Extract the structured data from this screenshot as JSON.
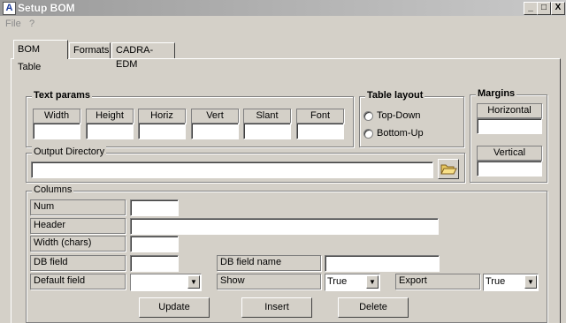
{
  "window": {
    "title": "Setup BOM",
    "minimize": "_",
    "maximize": "□",
    "close": "X"
  },
  "menu": {
    "file": "File",
    "help": "?"
  },
  "tabs": [
    {
      "label": "BOM Table",
      "active": true
    },
    {
      "label": "Formats",
      "active": false
    },
    {
      "label": "CADRA-EDM",
      "active": false
    }
  ],
  "text_params": {
    "title": "Text params",
    "columns": [
      "Width",
      "Height",
      "Horiz",
      "Vert",
      "Slant",
      "Font"
    ],
    "values": [
      "",
      "",
      "",
      "",
      "",
      ""
    ]
  },
  "table_layout": {
    "title": "Table layout",
    "options": [
      "Top-Down",
      "Bottom-Up"
    ],
    "selected": ""
  },
  "margins": {
    "title": "Margins",
    "horizontal_label": "Horizontal",
    "horizontal_value": "",
    "vertical_label": "Vertical",
    "vertical_value": ""
  },
  "output_directory": {
    "label": "Output Directory",
    "value": ""
  },
  "columns_group": {
    "title": "Columns",
    "num_label": "Num",
    "num_value": "",
    "header_label": "Header",
    "header_value": "",
    "width_label": "Width  (chars)",
    "width_value": "",
    "db_field_label": "DB field",
    "db_field_value": "",
    "db_field_name_label": "DB field name",
    "db_field_name_value": "",
    "default_field_label": "Default field",
    "default_field_value": "",
    "show_label": "Show",
    "show_value": "True",
    "export_label": "Export",
    "export_value": "True"
  },
  "buttons": {
    "update": "Update",
    "insert": "Insert",
    "delete": "Delete"
  },
  "colors": {
    "titlebar": "#a0a0a0",
    "face": "#d4d0c8"
  }
}
